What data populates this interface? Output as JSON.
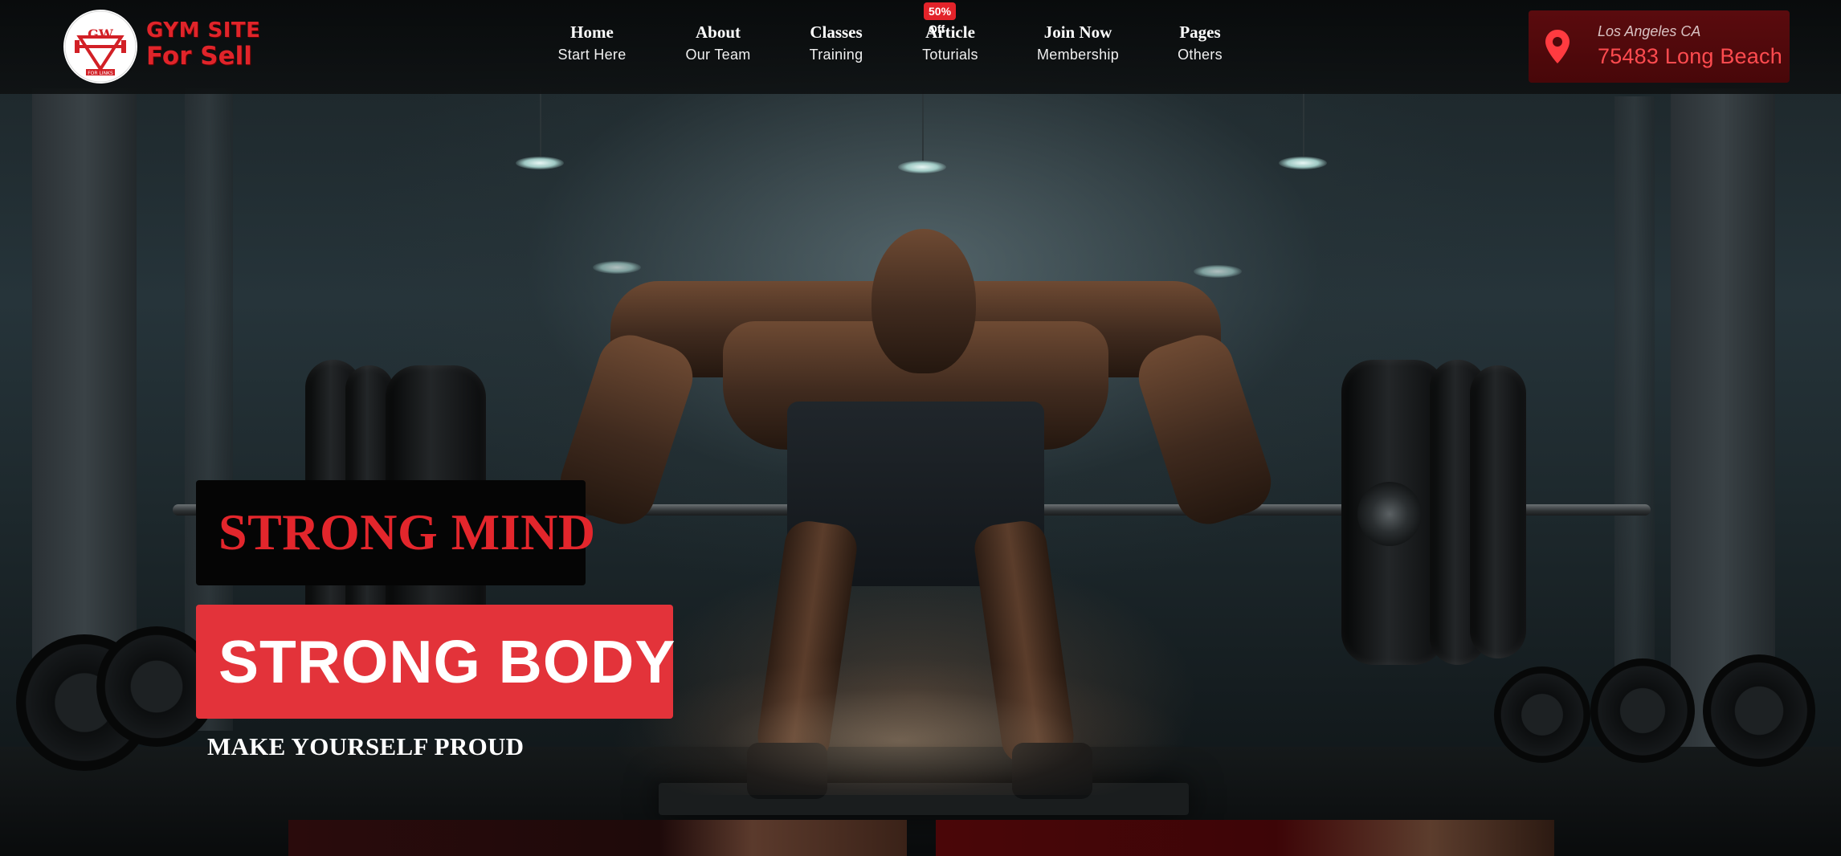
{
  "brand": {
    "line1": "GYM SITE",
    "line2": "For Sell",
    "emblem_letters": "GW",
    "emblem_ribbon": "FOR LINKS",
    "logo_icon": "dumbbell-emblem-icon",
    "accent_color": "#e3232a"
  },
  "nav": {
    "items": [
      {
        "label": "Home",
        "sub": "Start Here"
      },
      {
        "label": "About",
        "sub": "Our Team"
      },
      {
        "label": "Classes",
        "sub": "Training"
      },
      {
        "label": "Article",
        "sub": "Toturials"
      },
      {
        "label": "Join Now",
        "sub": "Membership"
      },
      {
        "label": "Pages",
        "sub": "Others"
      }
    ],
    "badge": "50% Off"
  },
  "location": {
    "icon": "map-pin-icon",
    "city": "Los Angeles CA",
    "street": "75483 Long Beach"
  },
  "hero": {
    "title_1": "STRONG MIND",
    "title_2": "STRONG BODY",
    "tagline": "MAKE YOURSELF PROUD",
    "background": "deadlift-gym-photo"
  }
}
